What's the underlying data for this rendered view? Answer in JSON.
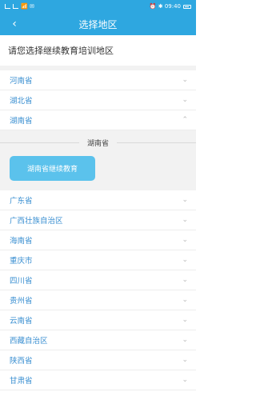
{
  "status": {
    "left": "📶 ✉",
    "right": "⏰ ✱ 09:40"
  },
  "header": {
    "title": "选择地区",
    "back_icon": "‹"
  },
  "prompt": "请您选择继续教育培训地区",
  "provinces_top": [
    {
      "label": "河南省",
      "chevron": "⌄"
    },
    {
      "label": "湖北省",
      "chevron": "⌄"
    },
    {
      "label": "湖南省",
      "chevron": "⌃"
    }
  ],
  "expanded": {
    "title": "湖南省",
    "button": "湖南省继续教育"
  },
  "provinces_bottom": [
    {
      "label": "广东省",
      "chevron": "⌄"
    },
    {
      "label": "广西壮族自治区",
      "chevron": "⌄"
    },
    {
      "label": "海南省",
      "chevron": "⌄"
    },
    {
      "label": "重庆市",
      "chevron": "⌄"
    },
    {
      "label": "四川省",
      "chevron": "⌄"
    },
    {
      "label": "贵州省",
      "chevron": "⌄"
    },
    {
      "label": "云南省",
      "chevron": "⌄"
    },
    {
      "label": "西藏自治区",
      "chevron": "⌄"
    },
    {
      "label": "陕西省",
      "chevron": "⌄"
    },
    {
      "label": "甘肃省",
      "chevron": "⌄"
    }
  ],
  "colors": {
    "accent": "#2ea7e0",
    "link": "#3a8fd1",
    "pill": "#5bc2ec"
  }
}
